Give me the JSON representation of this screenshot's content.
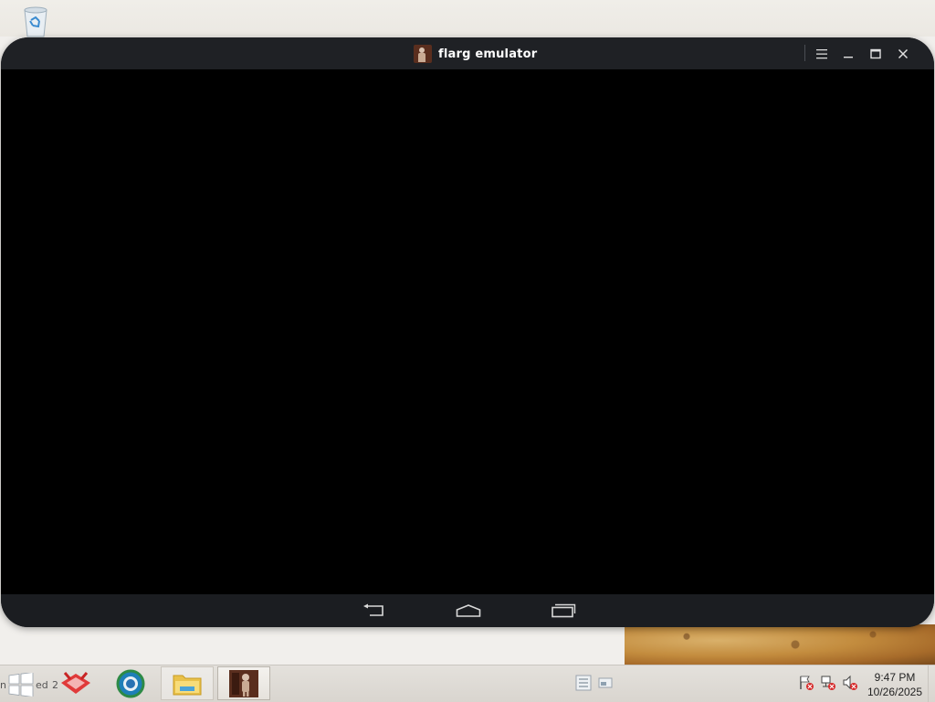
{
  "window": {
    "title": "flarg emulator",
    "menu_icon": "hamburger-menu-icon",
    "minimize_icon": "minimize-icon",
    "maximize_icon": "maximize-icon",
    "close_icon": "close-icon"
  },
  "navbar": {
    "back_icon": "back-icon",
    "home_icon": "home-icon",
    "recents_icon": "recent-apps-icon"
  },
  "desktop": {
    "icons": [
      "recycle-bin-icon"
    ]
  },
  "taskbar": {
    "partial_left_text": "n",
    "partial_text_1": "ed",
    "partial_text_2": "2",
    "apps": [
      "red-app-icon",
      "chrome-browser-icon",
      "file-explorer-icon",
      "flarg-emulator-icon"
    ],
    "clock_time": "9:47 PM",
    "clock_date": "10/26/2025"
  },
  "colors": {
    "window_bg": "#1d1f23",
    "screen": "#000000",
    "title_text": "#ffffff"
  }
}
